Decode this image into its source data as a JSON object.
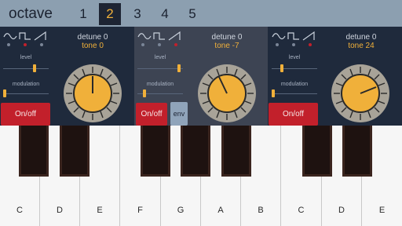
{
  "header": {
    "title": "octave",
    "octaves": [
      "1",
      "2",
      "3",
      "4",
      "5"
    ],
    "selected_octave": "2"
  },
  "colors": {
    "accent": "#f0b03a",
    "topbar": "#8c9fb0",
    "panel_dark": "#1f2a3c",
    "panel_selected": "#3d4453",
    "button_red": "#c2202b",
    "env_button": "#90a4ba"
  },
  "oscillators": [
    {
      "detune": "detune 0",
      "tone": "tone 0",
      "level_label": "level",
      "modulation_label": "modulation",
      "level": 0.7,
      "modulation": 0.0,
      "onoff_label": "On/off",
      "waveform_icons": [
        "sine-wave-icon",
        "square-wave-icon",
        "sawtooth-wave-icon"
      ],
      "active_waveform": 1
    },
    {
      "detune": "detune 0",
      "tone": "tone -7",
      "level_label": "level",
      "modulation_label": "modulation",
      "level": 0.87,
      "modulation": 0.12,
      "onoff_label": "On/off",
      "env_label": "env",
      "waveform_icons": [
        "sine-wave-icon",
        "square-wave-icon",
        "sawtooth-wave-icon"
      ],
      "active_waveform": 2
    },
    {
      "detune": "detune 0",
      "tone": "tone 24",
      "level_label": "level",
      "modulation_label": "modulation",
      "level": 0.2,
      "modulation": 0.0,
      "onoff_label": "On/off",
      "waveform_icons": [
        "sine-wave-icon",
        "square-wave-icon",
        "sawtooth-wave-icon"
      ],
      "active_waveform": 2
    }
  ],
  "keyboard": {
    "white_keys": [
      "C",
      "D",
      "E",
      "F",
      "G",
      "A",
      "B",
      "C",
      "D",
      "E"
    ]
  }
}
